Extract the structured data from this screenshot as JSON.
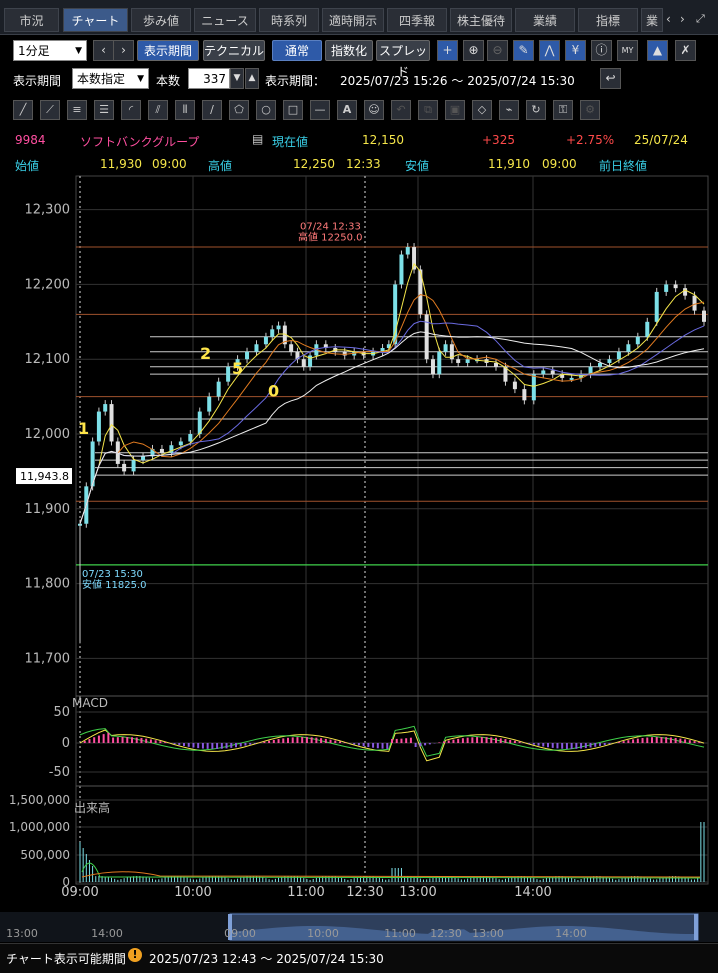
{
  "tabs": [
    "市況",
    "チャート",
    "歩み値",
    "ニュース",
    "時系列",
    "適時開示",
    "四季報",
    "株主優待",
    "業績",
    "指標",
    "業"
  ],
  "active_tab": "チャート",
  "toolbar1": {
    "interval": "1分足",
    "period_button": "表示期間",
    "technical_button": "テクニカル",
    "mode_normal": "通常",
    "mode_index": "指数化",
    "mode_spread": "スプレッド"
  },
  "toolbar2": {
    "period_label": "表示期間",
    "period_select": "本数指定",
    "count_label": "本数",
    "count_value": "337",
    "range_label": "表示期間：",
    "range_value": "2025/07/23 15:26 ～ 2025/07/24 15:30"
  },
  "stock": {
    "code": "9984",
    "name": "ソフトバンクグループ",
    "current_label": "現在値",
    "current_value": "12,150",
    "change": "+325",
    "change_pct": "+2.75%",
    "date": "25/07/24",
    "open_label": "始値",
    "open_value": "11,930",
    "open_time": "09:00",
    "high_label": "高値",
    "high_value": "12,250",
    "high_time": "12:33",
    "low_label": "安値",
    "low_value": "11,910",
    "low_time": "09:00",
    "prev_close_label": "前日終値"
  },
  "chart_data": {
    "type": "line",
    "title": "",
    "y_ticks": [
      "12,300",
      "12,200",
      "12,100",
      "12,000",
      "11,900",
      "11,800",
      "11,700"
    ],
    "ylim": [
      11655,
      12345
    ],
    "cursor_price": "11,943.8",
    "x_ticks": [
      "09:00",
      "10:00",
      "11:00",
      "12:30",
      "13:00",
      "14:00"
    ],
    "annotations": {
      "high_time": "07/24 12:33",
      "high_text": "高値 12250.0",
      "low_time": "07/23 15:30",
      "low_text": "安値 11825.0",
      "wave_labels": [
        "1",
        "2",
        "5",
        "0"
      ]
    },
    "price_series": [
      [
        0,
        11880
      ],
      [
        4,
        11930
      ],
      [
        8,
        11990
      ],
      [
        12,
        12030
      ],
      [
        16,
        12040
      ],
      [
        20,
        11990
      ],
      [
        24,
        11960
      ],
      [
        28,
        11950
      ],
      [
        34,
        11965
      ],
      [
        40,
        11970
      ],
      [
        46,
        11980
      ],
      [
        52,
        11975
      ],
      [
        58,
        11985
      ],
      [
        64,
        11990
      ],
      [
        70,
        12000
      ],
      [
        76,
        12030
      ],
      [
        82,
        12050
      ],
      [
        88,
        12070
      ],
      [
        94,
        12090
      ],
      [
        100,
        12100
      ],
      [
        106,
        12110
      ],
      [
        112,
        12120
      ],
      [
        118,
        12130
      ],
      [
        122,
        12140
      ],
      [
        126,
        12145
      ],
      [
        130,
        12120
      ],
      [
        134,
        12110
      ],
      [
        138,
        12100
      ],
      [
        142,
        12090
      ],
      [
        146,
        12105
      ],
      [
        150,
        12120
      ],
      [
        156,
        12115
      ],
      [
        162,
        12110
      ],
      [
        168,
        12105
      ],
      [
        174,
        12110
      ],
      [
        180,
        12105
      ],
      [
        186,
        12110
      ],
      [
        192,
        12115
      ],
      [
        196,
        12120
      ],
      [
        200,
        12200
      ],
      [
        204,
        12240
      ],
      [
        208,
        12250
      ],
      [
        212,
        12220
      ],
      [
        216,
        12160
      ],
      [
        220,
        12100
      ],
      [
        224,
        12080
      ],
      [
        228,
        12110
      ],
      [
        232,
        12120
      ],
      [
        236,
        12100
      ],
      [
        240,
        12095
      ],
      [
        246,
        12100
      ],
      [
        252,
        12100
      ],
      [
        258,
        12095
      ],
      [
        264,
        12090
      ],
      [
        270,
        12070
      ],
      [
        276,
        12060
      ],
      [
        282,
        12045
      ],
      [
        288,
        12080
      ],
      [
        294,
        12085
      ],
      [
        300,
        12080
      ],
      [
        306,
        12075
      ],
      [
        312,
        12075
      ],
      [
        318,
        12080
      ],
      [
        324,
        12090
      ],
      [
        330,
        12095
      ],
      [
        336,
        12100
      ],
      [
        342,
        12110
      ],
      [
        348,
        12120
      ],
      [
        354,
        12130
      ],
      [
        360,
        12150
      ],
      [
        366,
        12190
      ],
      [
        372,
        12200
      ],
      [
        378,
        12195
      ],
      [
        384,
        12185
      ],
      [
        390,
        12165
      ],
      [
        396,
        12150
      ]
    ],
    "horizontal_lines": [
      12250,
      12160,
      12130,
      12110,
      12090,
      12080,
      12050,
      12020,
      11975,
      11965,
      11955,
      11945,
      11910
    ],
    "green_line": 11825,
    "macd": {
      "label": "MACD",
      "ticks": [
        "50",
        "0",
        "-50"
      ]
    },
    "volume": {
      "label": "出来高",
      "ticks": [
        "1,500,000",
        "1,000,000",
        "500,000",
        "0"
      ]
    }
  },
  "navigator": {
    "ticks": [
      "13:00",
      "14:00",
      "09:00",
      "10:00",
      "11:00",
      "12:30",
      "13:00",
      "14:00"
    ]
  },
  "footer": {
    "label": "チャート表示可能期間",
    "warn_icon": "!",
    "range": "2025/07/23 12:43 ～ 2025/07/24 15:30"
  }
}
